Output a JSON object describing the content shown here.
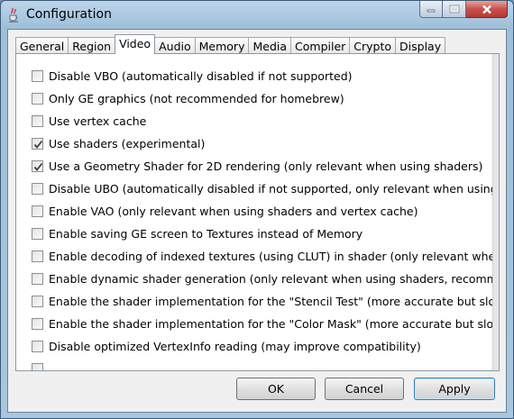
{
  "window": {
    "title": "Configuration"
  },
  "tabs": [
    {
      "label": "General"
    },
    {
      "label": "Region"
    },
    {
      "label": "Video",
      "active": true
    },
    {
      "label": "Audio"
    },
    {
      "label": "Memory"
    },
    {
      "label": "Media"
    },
    {
      "label": "Compiler"
    },
    {
      "label": "Crypto"
    },
    {
      "label": "Display"
    }
  ],
  "options": [
    {
      "label": "Disable VBO (automatically disabled if not supported)",
      "checked": false
    },
    {
      "label": "Only GE graphics (not recommended for homebrew)",
      "checked": false
    },
    {
      "label": "Use vertex cache",
      "checked": false
    },
    {
      "label": "Use shaders (experimental)",
      "checked": true
    },
    {
      "label": "Use a Geometry Shader for 2D rendering (only relevant when using shaders)",
      "checked": true
    },
    {
      "label": "Disable UBO (automatically disabled if not supported, only relevant when using shaders",
      "checked": false
    },
    {
      "label": "Enable VAO (only relevant when using shaders and vertex cache)",
      "checked": false
    },
    {
      "label": "Enable saving GE screen to Textures instead of Memory",
      "checked": false
    },
    {
      "label": "Enable decoding of indexed textures (using CLUT) in shader (only relevant when using",
      "checked": false
    },
    {
      "label": "Enable dynamic shader generation (only relevant when using shaders, recommended f",
      "checked": false
    },
    {
      "label": "Enable the shader implementation for the \"Stencil Test\" (more accurate but slower)",
      "checked": false
    },
    {
      "label": "Enable the shader implementation for the \"Color Mask\" (more accurate but slower)",
      "checked": false
    },
    {
      "label": "Disable optimized VertexInfo reading (may improve compatibility)",
      "checked": false
    },
    {
      "label": "",
      "checked": false
    }
  ],
  "buttons": {
    "ok": "OK",
    "cancel": "Cancel",
    "apply": "Apply"
  },
  "icons": {
    "app": "java-cup-icon",
    "minimize": "minimize-icon",
    "maximize": "maximize-icon",
    "close": "close-icon",
    "check": "check-icon"
  }
}
